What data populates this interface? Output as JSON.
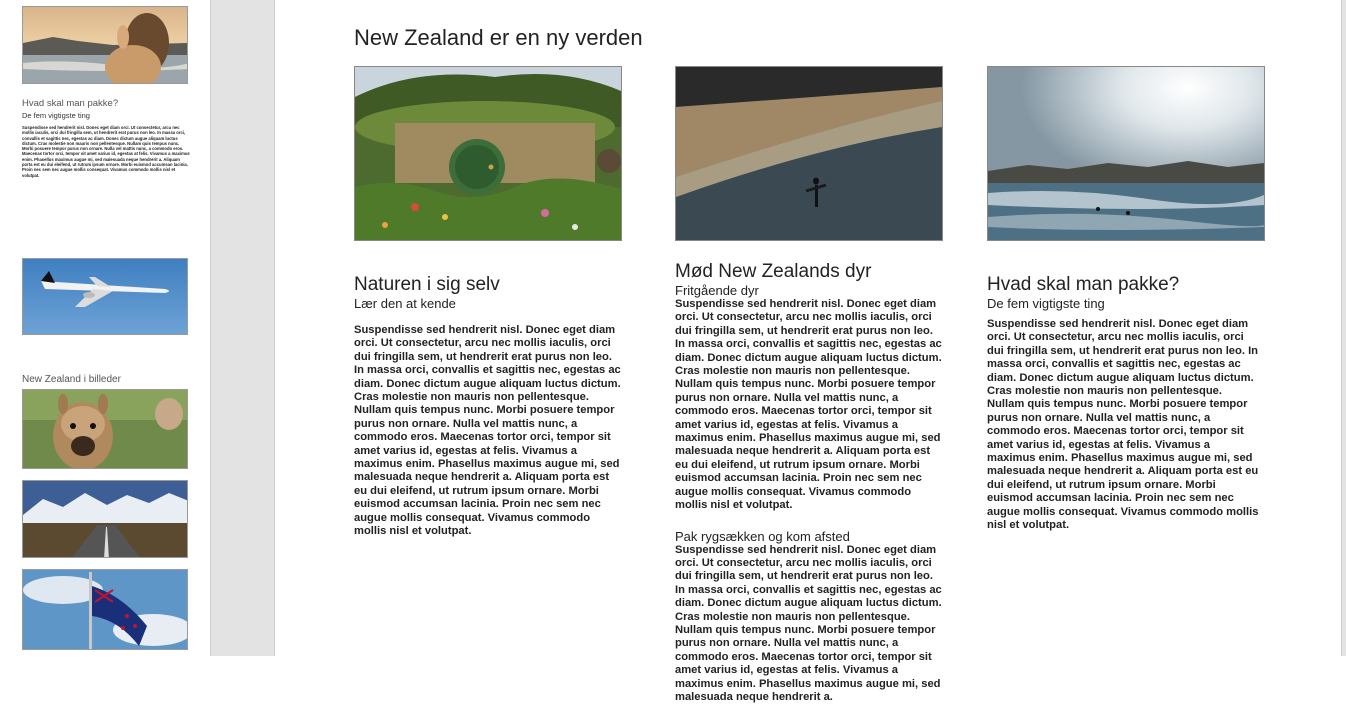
{
  "thumbnails": {
    "sidebar_heading": "Hvad skal man pakke?",
    "sidebar_subheading": "De fem vigtigste ting",
    "sidebar_body": "Suspendisse sed hendrerit nisl. Donec eget diam orci. Ut consectetur, arcu nec mollis iaculis, orci dui fringilla sem, ut hendrerit erat purus non leo. In massa orci, convallis et sagittis nec, egestas ac diam. Donec dictum augue aliquam luctus dictum. Cras molestie non mauris non pellentesque. Nullam quis tempus nunc. Morbi posuere tempor purus non ornare. Nulla vel mattis nunc, a commodo eros. Maecenas tortor orci, tempor sit amet varius id, egestas at felis. Vivamus a maximus enim. Phasellus maximus augue mi, sed malesuada neque hendrerit a. Aliquam porta est eu dui eleifend, ut rutrum ipsum ornare. Morbi euismod accumsan lacinia. Proin nec sem nec augue mollis consequat. Vivamus commodo mollis nisl et volutpat.",
    "gallery_label": "New Zealand i billeder"
  },
  "page": {
    "title": "New Zealand er en ny verden",
    "columns": [
      {
        "heading": "Naturen i sig selv",
        "subheading": "Lær den at kende",
        "body": "Suspendisse sed hendrerit nisl. Donec eget diam orci. Ut consectetur, arcu nec mollis iaculis, orci dui fringilla sem, ut hendrerit erat purus non leo. In massa orci, convallis et sagittis nec, egestas ac diam. Donec dictum augue aliquam luctus dictum. Cras molestie non mauris non pellentesque. Nullam quis tempus nunc. Morbi posuere tempor purus non ornare. Nulla vel mattis nunc, a commodo eros. Maecenas tortor orci, tempor sit amet varius id, egestas at felis. Vivamus a maximus enim. Phasellus maximus augue mi, sed malesuada neque hendrerit a. Aliquam porta est eu dui eleifend, ut rutrum ipsum ornare. Morbi euismod accumsan lacinia. Proin nec sem nec augue mollis consequat. Vivamus commodo mollis nisl et volutpat."
      },
      {
        "heading": "Mød New Zealands dyr",
        "subheading": "Fritgående dyr",
        "body": "Suspendisse sed hendrerit nisl. Donec eget diam orci. Ut consectetur, arcu nec mollis iaculis, orci dui fringilla sem, ut hendrerit erat purus non leo. In massa orci, convallis et sagittis nec, egestas ac diam. Donec dictum augue aliquam luctus dictum. Cras molestie non mauris non pellentesque. Nullam quis tempus nunc. Morbi posuere tempor purus non ornare. Nulla vel mattis nunc, a commodo eros. Maecenas tortor orci, tempor sit amet varius id, egestas at felis. Vivamus a maximus enim. Phasellus maximus augue mi, sed malesuada neque hendrerit a. Aliquam porta est eu dui eleifend, ut rutrum ipsum ornare. Morbi euismod accumsan lacinia. Proin nec sem nec augue mollis consequat. Vivamus commodo mollis nisl et volutpat.",
        "heading2": "Pak rygsækken og kom afsted",
        "body2": "Suspendisse sed hendrerit nisl. Donec eget diam orci. Ut consectetur, arcu nec mollis iaculis, orci dui fringilla sem, ut hendrerit erat purus non leo. In massa orci, convallis et sagittis nec, egestas ac diam. Donec dictum augue aliquam luctus dictum. Cras molestie non mauris non pellentesque. Nullam quis tempus nunc. Morbi posuere tempor purus non ornare. Nulla vel mattis nunc, a commodo eros. Maecenas tortor orci, tempor sit amet varius id, egestas at felis. Vivamus a maximus enim. Phasellus maximus augue mi, sed malesuada neque hendrerit a."
      },
      {
        "heading": "Hvad skal man pakke?",
        "subheading": "De fem vigtigste ting",
        "body": "Suspendisse sed hendrerit nisl. Donec eget diam orci. Ut consectetur, arcu nec mollis iaculis, orci dui fringilla sem, ut hendrerit erat purus non leo. In massa orci, convallis et sagittis nec, egestas ac diam. Donec dictum augue aliquam luctus dictum. Cras molestie non mauris non pellentesque. Nullam quis tempus nunc. Morbi posuere tempor purus non ornare. Nulla vel mattis nunc, a commodo eros. Maecenas tortor orci, tempor sit amet varius id, egestas at felis. Vivamus a maximus enim. Phasellus maximus augue mi, sed malesuada neque hendrerit a. Aliquam porta est eu dui eleifend, ut rutrum ipsum ornare. Morbi euismod accumsan lacinia. Proin nec sem nec augue mollis consequat. Vivamus commodo mollis nisl et volutpat."
      }
    ]
  },
  "colors": {
    "gutter": "#e3e3e3",
    "text": "#222222"
  }
}
